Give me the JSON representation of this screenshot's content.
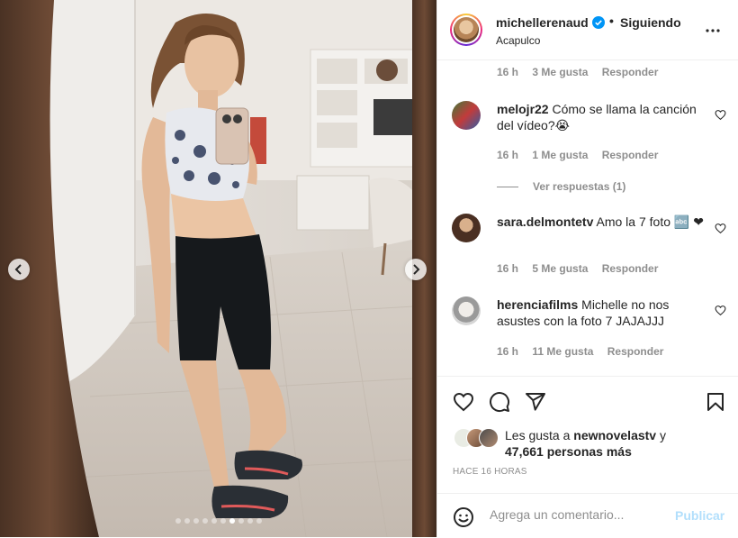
{
  "header": {
    "username": "michellerenaud",
    "separator": "•",
    "follow_status": "Siguiendo",
    "location": "Acapulco"
  },
  "comments": {
    "top_meta": {
      "time": "16 h",
      "likes": "3 Me gusta",
      "reply": "Responder"
    },
    "items": [
      {
        "username": "melojr22",
        "text": "Cómo se llama la canción del vídeo?😭",
        "time": "16 h",
        "likes": "1 Me gusta",
        "reply": "Responder",
        "view_replies": "Ver respuestas (1)"
      },
      {
        "username": "sara.delmontetv",
        "text": "Amo la 7 foto 🔤 ❤",
        "time": "16 h",
        "likes": "5 Me gusta",
        "reply": "Responder"
      },
      {
        "username": "herenciafilms",
        "text": "Michelle no nos asustes con la foto 7 JAJAJJJ",
        "time": "16 h",
        "likes": "11 Me gusta",
        "reply": "Responder"
      }
    ]
  },
  "likes": {
    "prefix": "Les gusta a ",
    "user": "newnovelastv",
    "suffix": " y",
    "count": "47,661 personas más"
  },
  "timestamp": "HACE 16 HORAS",
  "add_comment": {
    "placeholder": "Agrega un comentario...",
    "publish_label": "Publicar"
  },
  "carousel": {
    "total": 10,
    "active_index": 6
  },
  "colors": {
    "primary_text": "#262626",
    "secondary_text": "#8e8e8e",
    "verified": "#0095f6",
    "publish_disabled": "#b2dffc"
  },
  "icons": [
    "verified-badge-icon",
    "more-options-icon",
    "heart-icon",
    "comment-icon",
    "share-icon",
    "bookmark-icon",
    "emoji-icon",
    "chevron-left-icon",
    "chevron-right-icon"
  ]
}
